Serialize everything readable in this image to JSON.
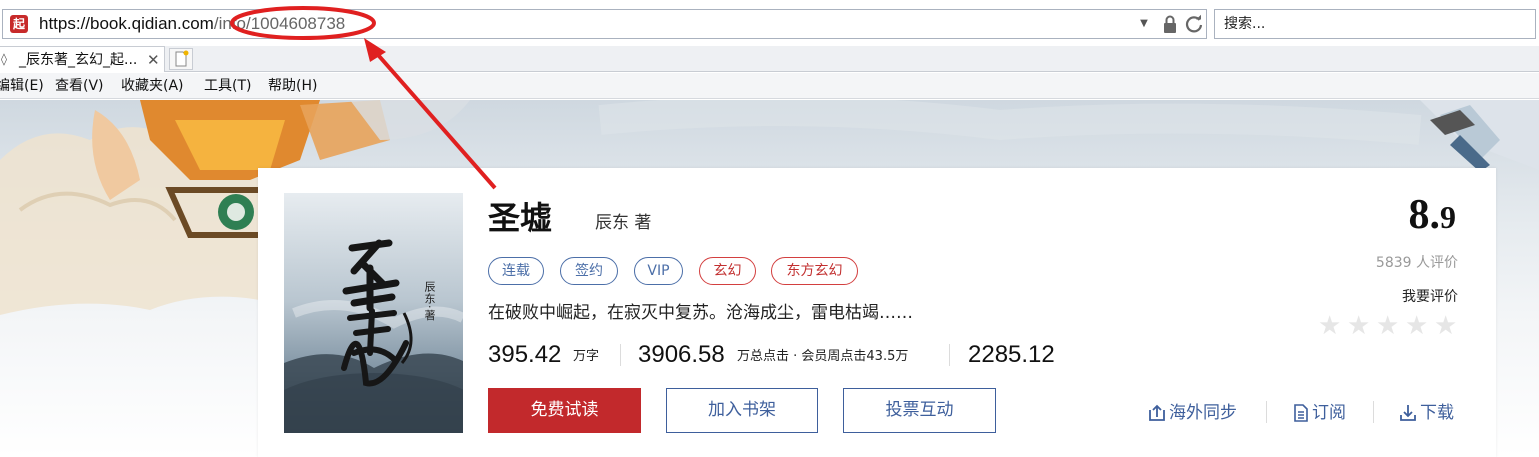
{
  "browser": {
    "url_prefix": "https://book.",
    "url_host": "qidian.com",
    "url_path": "/info/1004608738",
    "favicon": "起",
    "search_placeholder": "搜索...",
    "tab_title": "_辰东著_玄幻_起...",
    "tab_close": "✕",
    "menu": [
      "编辑(E)",
      "查看(V)",
      "收藏夹(A)",
      "工具(T)",
      "帮助(H)"
    ]
  },
  "book": {
    "title": "圣墟",
    "author": "辰东 著",
    "cover_author": "辰东·著",
    "tags": [
      {
        "label": "连载",
        "style": "blue"
      },
      {
        "label": "签约",
        "style": "blue"
      },
      {
        "label": "VIP",
        "style": "blue"
      },
      {
        "label": "玄幻",
        "style": "red"
      },
      {
        "label": "东方玄幻",
        "style": "red"
      }
    ],
    "intro": "在破败中崛起，在寂灭中复苏。沧海成尘，雷电枯竭……",
    "stats": {
      "words": "395.42",
      "words_unit": "万字",
      "clicks": "3906.58",
      "clicks_unit": "万总点击 · 会员周点击43.5万",
      "recommend": "2285.12"
    },
    "buttons": {
      "read": "免费试读",
      "shelf": "加入书架",
      "vote": "投票互动"
    },
    "tools": {
      "overseas": "海外同步",
      "subscribe": "订阅",
      "download": "下载"
    },
    "rating": {
      "score_int": "8.",
      "score_dec": "9",
      "count": "5839",
      "count_label": "人评价",
      "rate_me": "我要评价",
      "star": "★"
    }
  },
  "colors": {
    "primary_red": "#c2292c",
    "link_blue": "#3e5f9c",
    "annotation_red": "#e02020"
  }
}
